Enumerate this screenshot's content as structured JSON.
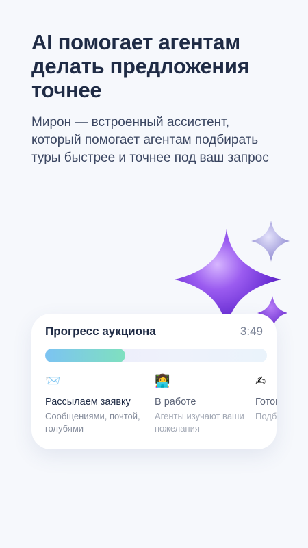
{
  "headline": "AI помогает агентам делать предложения точнее",
  "subtext": "Мирон — встроенный ассистент, который помогает агентам подбирать туры быстрее и точнее под ваш запрос",
  "card": {
    "title": "Прогресс аукциона",
    "timer": "3:49",
    "progress_fraction": 0.36,
    "steps": [
      {
        "icon": "envelope-icon",
        "glyph": "📨",
        "title": "Рассылаем заявку",
        "desc": "Сообщениями, почтой, голубями"
      },
      {
        "icon": "person-at-laptop-icon",
        "glyph": "👩‍💻",
        "title": "В работе",
        "desc": "Агенты изучают ваши пожелания"
      },
      {
        "icon": "writing-hand-icon",
        "glyph": "✍",
        "title": "Готово",
        "desc": "Подбираем варианты"
      }
    ]
  },
  "colors": {
    "background": "#f6f8fc",
    "headline": "#1f2b45",
    "sparkle_purple": "#7a3fe0",
    "sparkle_lilac": "#a7a3dc",
    "progress_start": "#7cc3f2",
    "progress_end": "#7fe0bf"
  }
}
